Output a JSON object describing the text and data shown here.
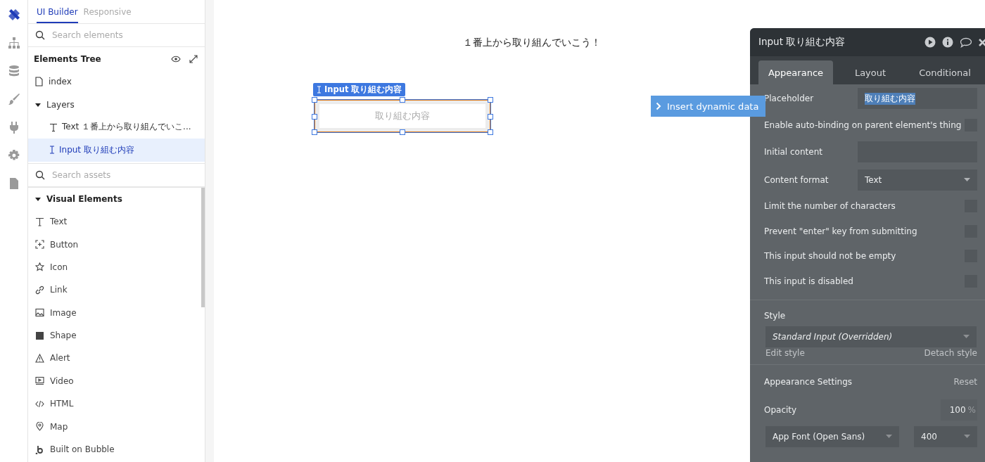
{
  "rail": [
    {
      "kind": "design",
      "selected": true
    },
    {
      "kind": "tree",
      "selected": false
    },
    {
      "kind": "data",
      "selected": false
    },
    {
      "kind": "brush",
      "selected": false
    },
    {
      "kind": "plug",
      "selected": false
    },
    {
      "kind": "gear",
      "selected": false
    },
    {
      "kind": "document",
      "selected": false
    }
  ],
  "tabs": [
    {
      "label": "UI Builder",
      "selected": true
    },
    {
      "label": "Responsive",
      "selected": false
    }
  ],
  "search_elements": {
    "placeholder": "Search elements"
  },
  "elements_tree": {
    "title": "Elements Tree",
    "page": "index",
    "layers": {
      "label": "Layers",
      "expanded": true,
      "children": [
        {
          "kind": "text",
          "label": "Text １番上から取り組んでいこ...",
          "selected": false
        },
        {
          "kind": "input",
          "label": "Input 取り組む内容",
          "selected": true
        }
      ]
    }
  },
  "search_assets": {
    "placeholder": "Search assets"
  },
  "visual_elements": {
    "title": "Visual Elements",
    "expanded": true,
    "items": [
      {
        "kind": "text",
        "label": "Text"
      },
      {
        "kind": "button",
        "label": "Button"
      },
      {
        "kind": "icon",
        "label": "Icon"
      },
      {
        "kind": "link",
        "label": "Link"
      },
      {
        "kind": "image",
        "label": "Image"
      },
      {
        "kind": "shape",
        "label": "Shape"
      },
      {
        "kind": "alert",
        "label": "Alert"
      },
      {
        "kind": "video",
        "label": "Video"
      },
      {
        "kind": "html",
        "label": "HTML"
      },
      {
        "kind": "map",
        "label": "Map"
      },
      {
        "kind": "bubble",
        "label": "Built on Bubble"
      }
    ]
  },
  "canvas": {
    "heading": "１番上から取り組んでいこう！",
    "input_tag": "Input 取り組む内容",
    "input_placeholder": "取り組む内容"
  },
  "insert_dynamic_data": "Insert dynamic data",
  "property_editor": {
    "title": "Input 取り組む内容",
    "tabs": [
      {
        "label": "Appearance",
        "selected": true
      },
      {
        "label": "Layout",
        "selected": false
      },
      {
        "label": "Conditional",
        "selected": false
      }
    ],
    "rows": [
      {
        "kind": "text",
        "label": "Placeholder",
        "value": "取り組む内容"
      },
      {
        "kind": "checkbox",
        "label": "Enable auto-binding on parent element's thing",
        "checked": false
      },
      {
        "kind": "text",
        "label": "Initial content"
      },
      {
        "kind": "dropdown",
        "label": "Content format",
        "value": "Text"
      },
      {
        "kind": "checkbox",
        "label": "Limit the number of characters",
        "checked": false
      },
      {
        "kind": "checkbox",
        "label": "Prevent \"enter\" key from submitting",
        "checked": false
      },
      {
        "kind": "checkbox",
        "label": "This input should not be empty",
        "checked": false
      },
      {
        "kind": "checkbox",
        "label": "This input is disabled",
        "checked": false
      }
    ],
    "style": {
      "label": "Style",
      "value": "Standard Input (Overridden)",
      "edit": "Edit style",
      "detach": "Detach style"
    },
    "appearance_settings": {
      "label": "Appearance Settings",
      "reset": "Reset",
      "opacity_label": "Opacity",
      "opacity_value": "100",
      "opacity_unit": "%",
      "font": "App Font (Open Sans)",
      "weight": "400"
    }
  }
}
